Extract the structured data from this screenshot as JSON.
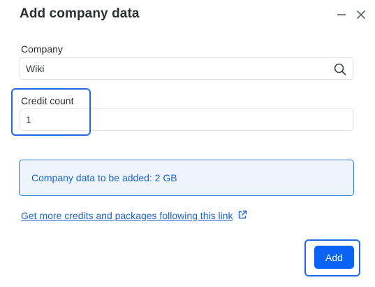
{
  "dialog": {
    "title": "Add company data",
    "icons": {
      "minimize": "minimize-icon",
      "close": "close-icon"
    }
  },
  "company": {
    "label": "Company",
    "value": "Wiki",
    "icon": "search-icon"
  },
  "credit": {
    "label": "Credit count",
    "value": "1"
  },
  "info": {
    "text": "Company data to be added: 2 GB"
  },
  "link": {
    "text": "Get more credits and packages following this link",
    "icon": "external-link-icon"
  },
  "actions": {
    "add_label": "Add"
  },
  "colors": {
    "accent": "#0b63f6",
    "highlight": "#1f6ae0",
    "info_bg": "#eef5fd",
    "link": "#1f62c9"
  }
}
